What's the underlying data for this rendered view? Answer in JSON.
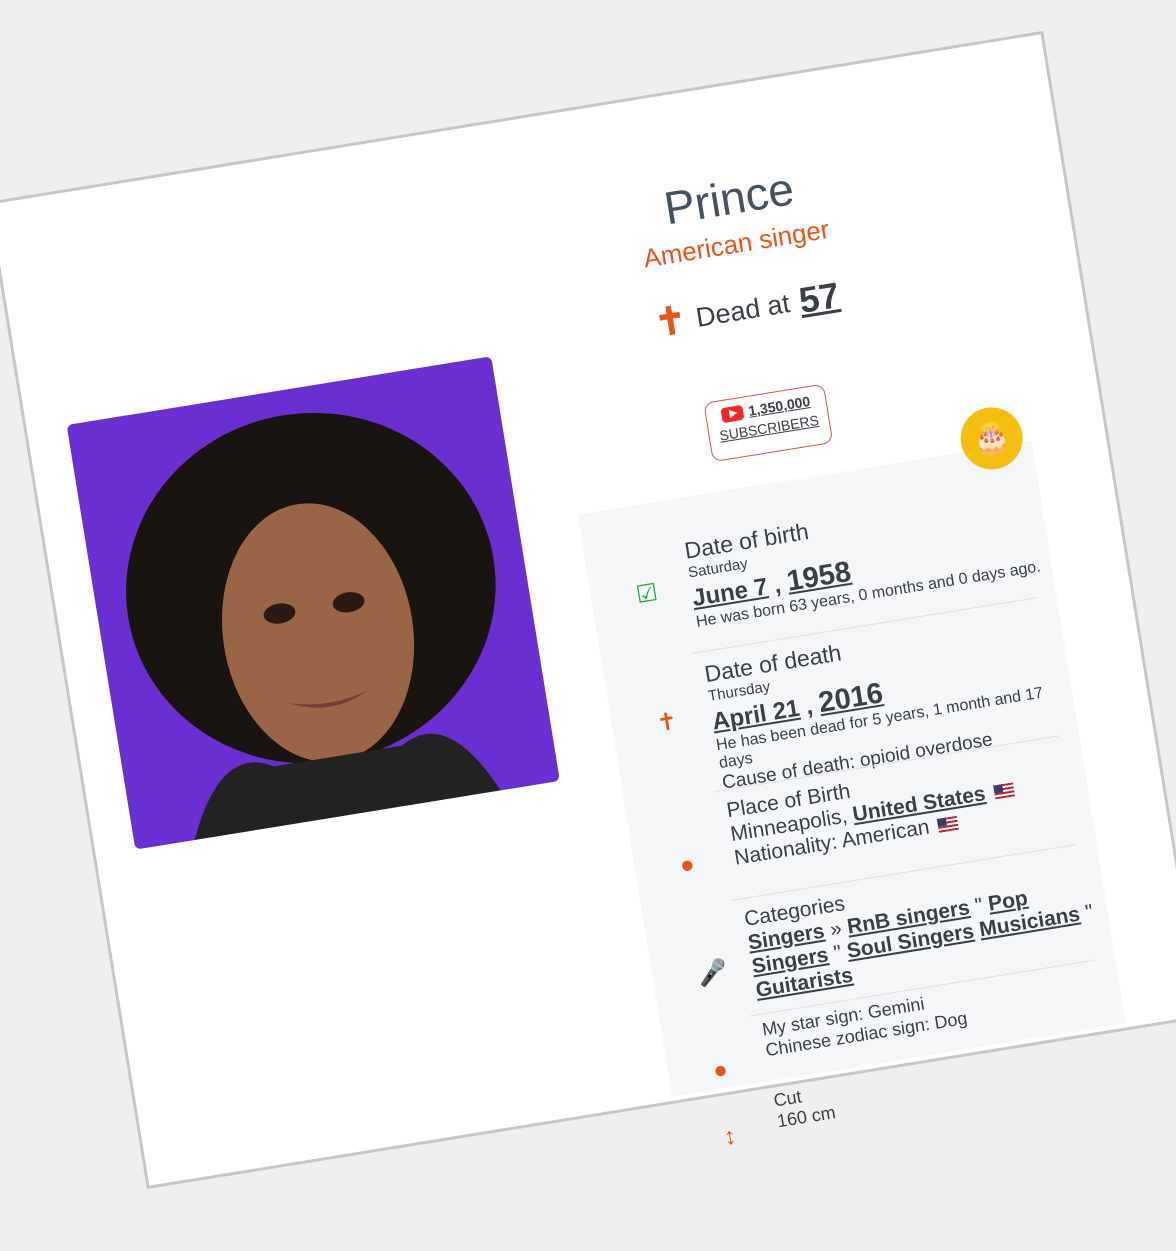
{
  "person": {
    "name": "Prince",
    "role": "American singer",
    "dead_prefix": "Dead at",
    "age": "57"
  },
  "youtube": {
    "subscribers": "1,350,000",
    "label": "SUBSCRIBERS"
  },
  "birth": {
    "label": "Date of birth",
    "weekday": "Saturday",
    "day": "June 7",
    "sep": ",",
    "year": "1958",
    "note": "He was born 63 years, 0 months and 0 days ago."
  },
  "death": {
    "label": "Date of death",
    "weekday": "Thursday",
    "day": "April 21",
    "sep": ",",
    "year": "2016",
    "note": "He has been dead for 5 years, 1 month and 17 days",
    "cause": "Cause of death: opioid overdose"
  },
  "place": {
    "label": "Place of Birth",
    "city": "Minneapolis,",
    "country": "United States",
    "nationality": "Nationality: American"
  },
  "categories": {
    "label": "Categories",
    "items": [
      "Singers",
      "RnB singers",
      "Pop Singers",
      "Soul Singers",
      "Musicians",
      "Guitarists"
    ],
    "sep_arrow": "»",
    "sep_quote": "\""
  },
  "zodiac": {
    "star": "My star sign: Gemini",
    "chinese": "Chinese zodiac sign: Dog"
  },
  "height": {
    "label": "Cut",
    "value": "160 cm"
  },
  "colors": {
    "accent": "#e8551a",
    "text": "#3a3f46",
    "cake": "#f7be12",
    "panel": "#f5f6f8"
  }
}
